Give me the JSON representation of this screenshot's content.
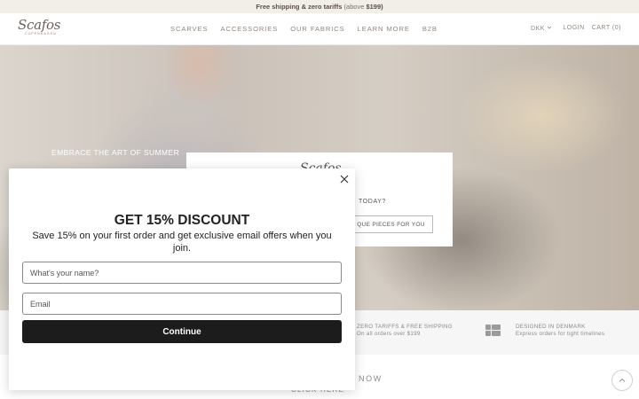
{
  "announcement": {
    "bold": "Free shipping & zero tariffs",
    "light": "(above",
    "amount": "$199)"
  },
  "header": {
    "logo_word": "Scafos",
    "logo_sub": "COPENHAGEN",
    "nav": [
      "SCARVES",
      "ACCESSORIES",
      "OUR FABRICS",
      "LEARN MORE",
      "B2B"
    ],
    "currency": "DKK",
    "login": "LOGIN",
    "cart": "CART (0)"
  },
  "hero": {
    "tagline": "EMBRACE THE ART OF SUMMER",
    "mini_popup": {
      "logo": "Scafos",
      "question": "TODAY?",
      "button": "QUE PIECES FOR YOU"
    }
  },
  "usps": [
    {
      "title": "ZERO TARIFFS & FREE SHIPPING",
      "subtitle": "On all orders over $199"
    },
    {
      "title": "DESIGNED IN DENMARK",
      "subtitle": "Express orders for tight timelines"
    }
  ],
  "below": {
    "now": "NOW",
    "click": "CLICK HERE"
  },
  "modal": {
    "title": "GET 15% DISCOUNT",
    "subtitle": "Save 15% on your first order and get exclusive email offers when you join.",
    "name_placeholder": "What's your name?",
    "email_placeholder": "Email",
    "submit_label": "Continue"
  },
  "colors": {
    "announce_bg": "#f2efe9",
    "button_bg": "#1c1c1c",
    "nav_text": "#8f867c"
  }
}
